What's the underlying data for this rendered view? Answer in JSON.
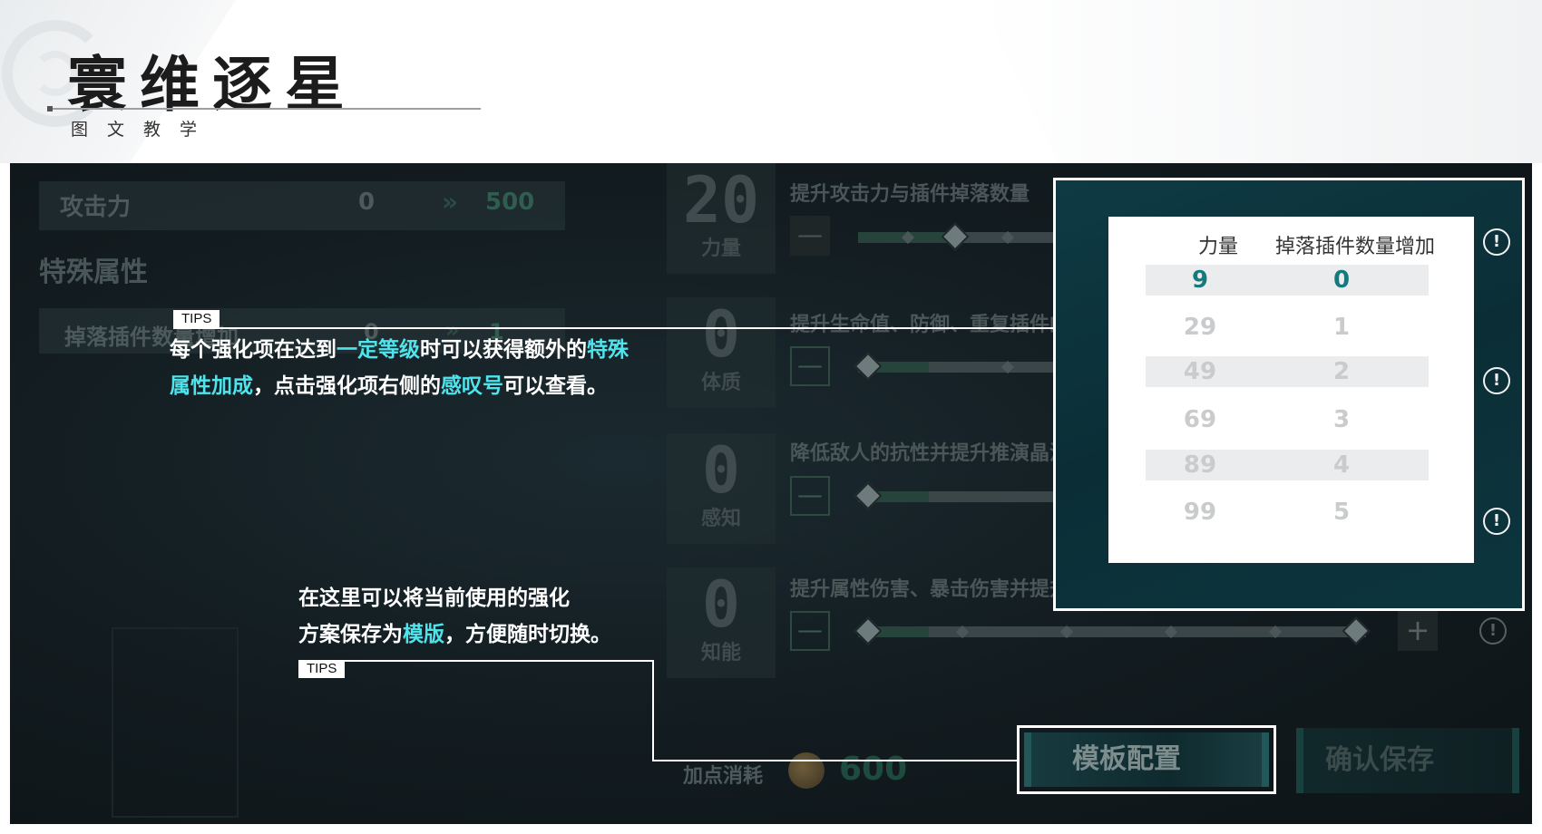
{
  "header": {
    "title": "寰维逐星",
    "subtitle": "图文教学"
  },
  "game": {
    "attack_row": {
      "label": "攻击力",
      "current": "0",
      "arrow": "»",
      "next": "500"
    },
    "special_heading": "特殊属性",
    "drop_row": {
      "label": "掉落插件数量增加",
      "current": "0",
      "arrow": "»",
      "next": "1"
    },
    "attributes": [
      {
        "value": "20",
        "name": "力量",
        "desc": "提升攻击力与插件掉落数量",
        "progress": 0.19
      },
      {
        "value": "0",
        "name": "体质",
        "desc": "提升生命值、防御、重复插件的转化",
        "progress": 0.0
      },
      {
        "value": "0",
        "name": "感知",
        "desc": "降低敌人的抗性并提升推演晶流的",
        "progress": 0.0
      },
      {
        "value": "0",
        "name": "知能",
        "desc": "提升属性伤害、暴击伤害并提升超维值获取率",
        "progress": 0.0
      }
    ],
    "minus_symbol": "—",
    "plus_symbol": "+",
    "info_symbol": "!",
    "cost_label": "加点消耗",
    "cost_value": "600",
    "template_button": "模板配置",
    "confirm_button": "确认保存"
  },
  "popup": {
    "col1_header": "力量",
    "col2_header": "掉落插件数量增加",
    "rows": [
      {
        "a": "9",
        "b": "0"
      },
      {
        "a": "29",
        "b": "1"
      },
      {
        "a": "49",
        "b": "2"
      },
      {
        "a": "69",
        "b": "3"
      },
      {
        "a": "89",
        "b": "4"
      },
      {
        "a": "99",
        "b": "5"
      }
    ]
  },
  "tips": {
    "tag": "TIPS",
    "tip1": {
      "p1": "每个强化项在达到",
      "h1": "一定等级",
      "p2": "时可以获得额外的",
      "h2": "特殊",
      "h3": "属性加成",
      "p3": "，点击强化项右侧的",
      "h4": "感叹号",
      "p4": "可以查看。"
    },
    "tip2": {
      "p1": "在这里可以将当前使用的强化",
      "p2": "方案保存为",
      "h1": "模版",
      "p3": "，方便随时切换。"
    }
  },
  "colors": {
    "highlight": "#4fe3ec",
    "accent_teal": "#157a7d",
    "frame": "#ffffff"
  }
}
